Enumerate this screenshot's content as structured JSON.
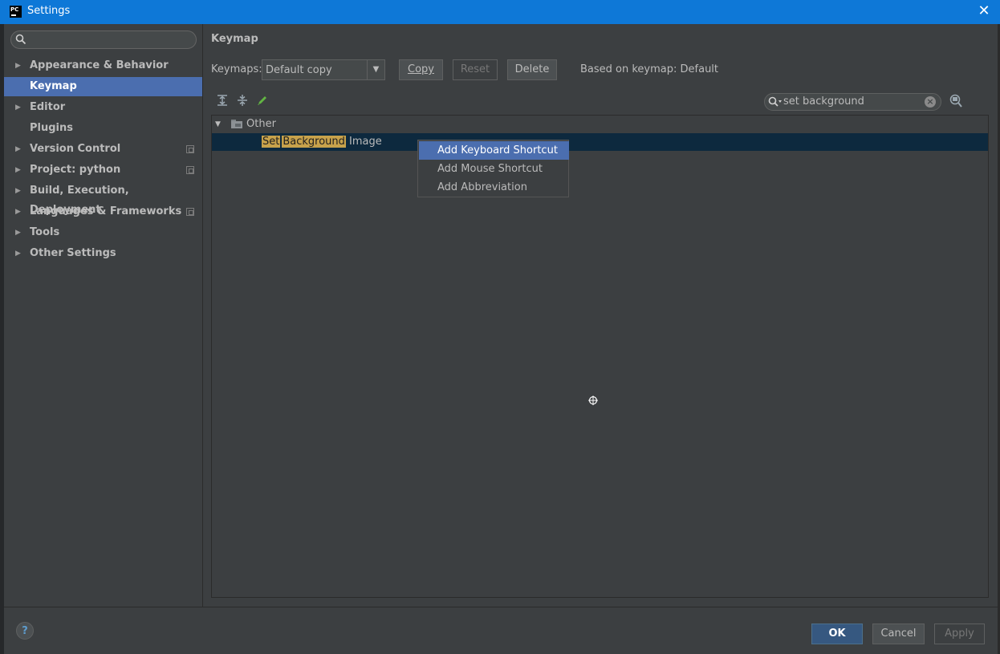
{
  "window": {
    "title": "Settings",
    "app_icon_text": "PC",
    "close_glyph": "✕"
  },
  "sidebar": {
    "search_placeholder": "",
    "items": [
      {
        "label": "Appearance & Behavior",
        "expandable": true
      },
      {
        "label": "Keymap",
        "expandable": false,
        "selected": true
      },
      {
        "label": "Editor",
        "expandable": true
      },
      {
        "label": "Plugins",
        "expandable": false
      },
      {
        "label": "Version Control",
        "expandable": true,
        "project_icon": true
      },
      {
        "label": "Project: python",
        "expandable": true,
        "project_icon": true
      },
      {
        "label": "Build, Execution, Deployment",
        "expandable": true
      },
      {
        "label": "Languages & Frameworks",
        "expandable": true,
        "project_icon": true
      },
      {
        "label": "Tools",
        "expandable": true
      },
      {
        "label": "Other Settings",
        "expandable": true
      }
    ]
  },
  "main": {
    "title": "Keymap",
    "keymaps_label": "Keymaps:",
    "keymap_selected": "Default copy",
    "buttons": {
      "copy": "Copy",
      "reset": "Reset",
      "delete": "Delete"
    },
    "based_on": "Based on keymap: Default",
    "filter_value": "set background",
    "tree": {
      "group": "Other",
      "action": {
        "hl1": "Set",
        "hl2": "Background",
        "rest": " Image"
      }
    },
    "context_menu": [
      "Add Keyboard Shortcut",
      "Add Mouse Shortcut",
      "Add Abbreviation"
    ]
  },
  "footer": {
    "help": "?",
    "ok": "OK",
    "cancel": "Cancel",
    "apply": "Apply"
  },
  "colors": {
    "titlebar": "#0e78d7",
    "selection": "#4b6eaf",
    "highlight": "#c7a24b",
    "background": "#3c3f41"
  }
}
